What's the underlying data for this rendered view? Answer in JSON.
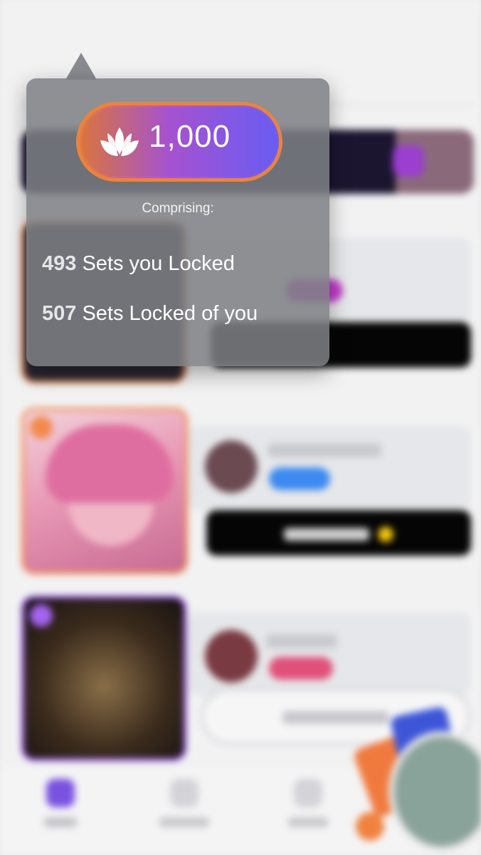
{
  "popover": {
    "score_value": "1,000",
    "comprising_label": "Comprising:",
    "stats": [
      {
        "count": "493",
        "label": "Sets you Locked"
      },
      {
        "count": "507",
        "label": "Sets Locked of you"
      }
    ]
  },
  "colors": {
    "accent_purple": "#6d5ef0",
    "accent_orange": "#e57a3e",
    "quickbuy_bar": "#050505",
    "coin": "#f1c40f"
  },
  "icons": {
    "score_icon": "lotus-icon",
    "coin_icon": "coin-icon"
  }
}
